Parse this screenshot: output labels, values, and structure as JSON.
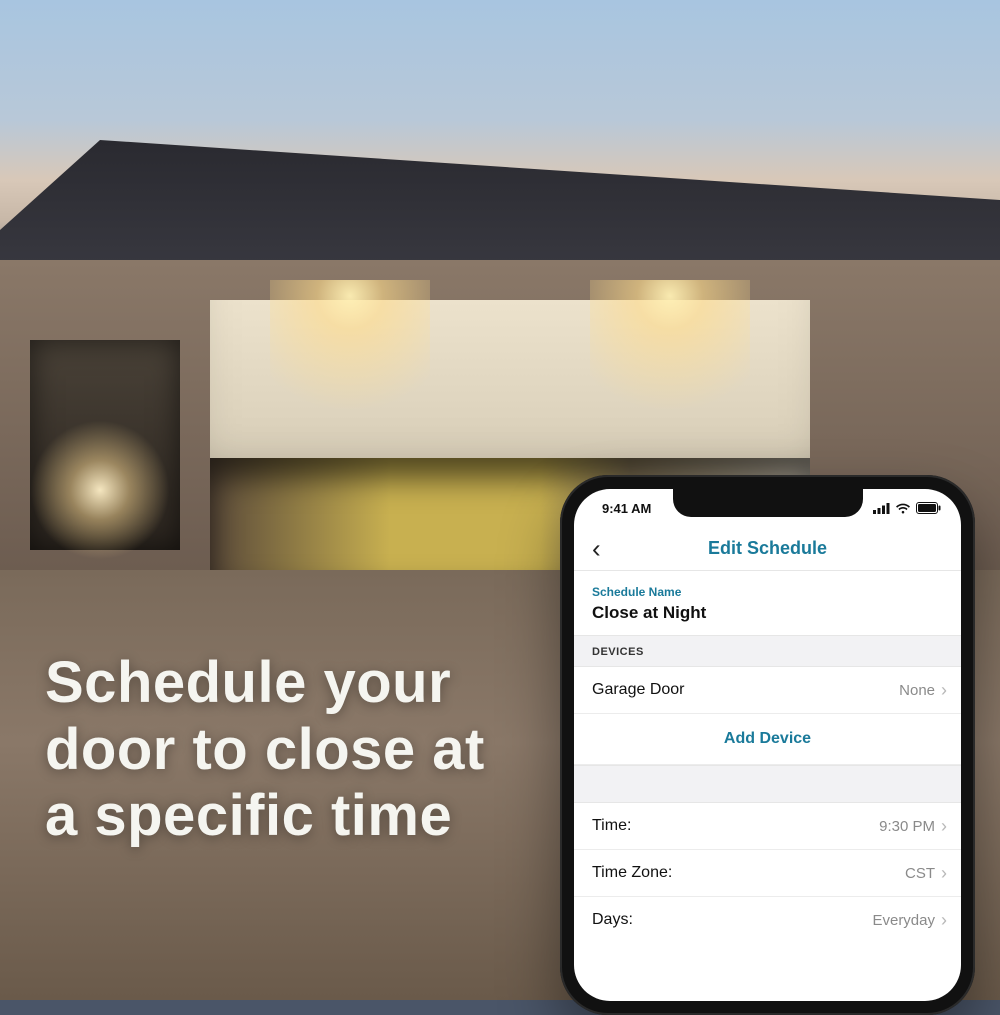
{
  "headline": "Schedule your door to close at a specific time",
  "status": {
    "time": "9:41 AM"
  },
  "nav": {
    "title": "Edit Schedule"
  },
  "schedule": {
    "name_label": "Schedule Name",
    "name_value": "Close at Night"
  },
  "devices": {
    "header": "DEVICES",
    "items": [
      {
        "label": "Garage Door",
        "value": "None"
      }
    ],
    "add_label": "Add Device"
  },
  "settings": {
    "rows": [
      {
        "label": "Time:",
        "value": "9:30 PM"
      },
      {
        "label": "Time Zone:",
        "value": "CST"
      },
      {
        "label": "Days:",
        "value": "Everyday"
      }
    ]
  },
  "colors": {
    "accent": "#1a7a9a"
  }
}
